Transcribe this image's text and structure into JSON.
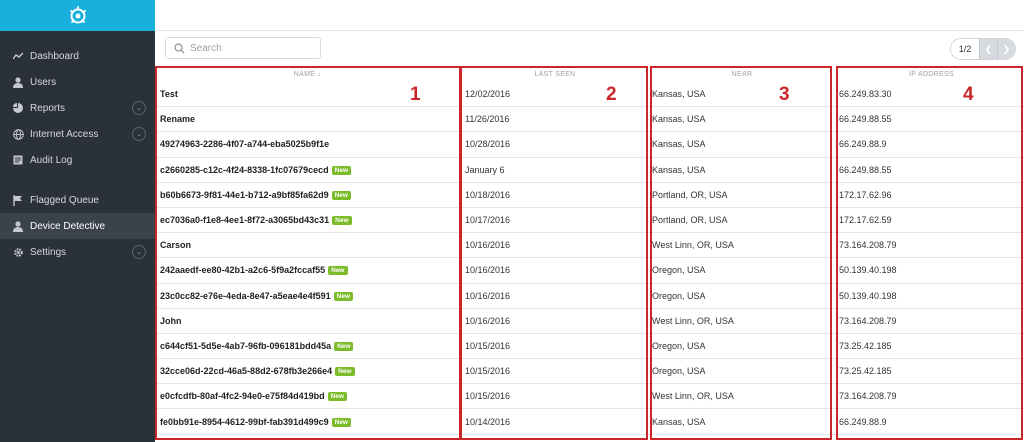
{
  "search": {
    "placeholder": "Search"
  },
  "pager": {
    "page": "1/2"
  },
  "sidebar": {
    "items": [
      {
        "label": "Dashboard",
        "icon": "chart-line-icon"
      },
      {
        "label": "Users",
        "icon": "user-icon"
      },
      {
        "label": "Reports",
        "icon": "pie-chart-icon",
        "expandable": true
      },
      {
        "label": "Internet Access",
        "icon": "globe-icon",
        "expandable": true
      },
      {
        "label": "Audit Log",
        "icon": "document-icon"
      },
      {
        "label": "Flagged Queue",
        "icon": "flag-icon"
      },
      {
        "label": "Device Detective",
        "icon": "user-icon",
        "active": true
      },
      {
        "label": "Settings",
        "icon": "gear-icon",
        "expandable": true
      }
    ]
  },
  "table": {
    "columns": [
      "NAME",
      "LAST SEEN",
      "NEAR",
      "IP ADDRESS"
    ],
    "sort_indicator": "↓",
    "badge_label": "New",
    "rows": [
      {
        "name": "Test",
        "new": false,
        "last_seen": "12/02/2016",
        "near": "Kansas, USA",
        "ip": "66.249.83.30"
      },
      {
        "name": "Rename",
        "new": false,
        "last_seen": "11/26/2016",
        "near": "Kansas, USA",
        "ip": "66.249.88.55"
      },
      {
        "name": "49274963-2286-4f07-a744-eba5025b9f1e",
        "new": false,
        "last_seen": "10/28/2016",
        "near": "Kansas, USA",
        "ip": "66.249.88.9"
      },
      {
        "name": "c2660285-c12c-4f24-8338-1fc07679cecd",
        "new": true,
        "last_seen": "January 6",
        "near": "Kansas, USA",
        "ip": "66.249.88.55"
      },
      {
        "name": "b60b6673-9f81-44e1-b712-a9bf85fa62d9",
        "new": true,
        "last_seen": "10/18/2016",
        "near": "Portland, OR, USA",
        "ip": "172.17.62.96"
      },
      {
        "name": "ec7036a0-f1e8-4ee1-8f72-a3065bd43c31",
        "new": true,
        "last_seen": "10/17/2016",
        "near": "Portland, OR, USA",
        "ip": "172.17.62.59"
      },
      {
        "name": "Carson",
        "new": false,
        "last_seen": "10/16/2016",
        "near": "West Linn, OR, USA",
        "ip": "73.164.208.79"
      },
      {
        "name": "242aaedf-ee80-42b1-a2c6-5f9a2fccaf55",
        "new": true,
        "last_seen": "10/16/2016",
        "near": "Oregon, USA",
        "ip": "50.139.40.198"
      },
      {
        "name": "23c0cc82-e76e-4eda-8e47-a5eae4e4f591",
        "new": true,
        "last_seen": "10/16/2016",
        "near": "Oregon, USA",
        "ip": "50.139.40.198"
      },
      {
        "name": "John",
        "new": false,
        "last_seen": "10/16/2016",
        "near": "West Linn, OR, USA",
        "ip": "73.164.208.79"
      },
      {
        "name": "c644cf51-5d5e-4ab7-96fb-096181bdd45a",
        "new": true,
        "last_seen": "10/15/2016",
        "near": "Oregon, USA",
        "ip": "73.25.42.185"
      },
      {
        "name": "32cce06d-22cd-46a5-88d2-678fb3e266e4",
        "new": true,
        "last_seen": "10/15/2016",
        "near": "Oregon, USA",
        "ip": "73.25.42.185"
      },
      {
        "name": "e0cfcdfb-80af-4fc2-94e0-e75f84d419bd",
        "new": true,
        "last_seen": "10/15/2016",
        "near": "West Linn, OR, USA",
        "ip": "73.164.208.79"
      },
      {
        "name": "fe0bb91e-8954-4612-99bf-fab391d499c9",
        "new": true,
        "last_seen": "10/14/2016",
        "near": "Kansas, USA",
        "ip": "66.249.88.9"
      }
    ]
  },
  "annotations": [
    "1",
    "2",
    "3",
    "4"
  ],
  "colors": {
    "sidebar": "#2b3138",
    "brand": "#1ab0dd",
    "badge": "#7cbc2b",
    "annotation": "#c8262b"
  }
}
